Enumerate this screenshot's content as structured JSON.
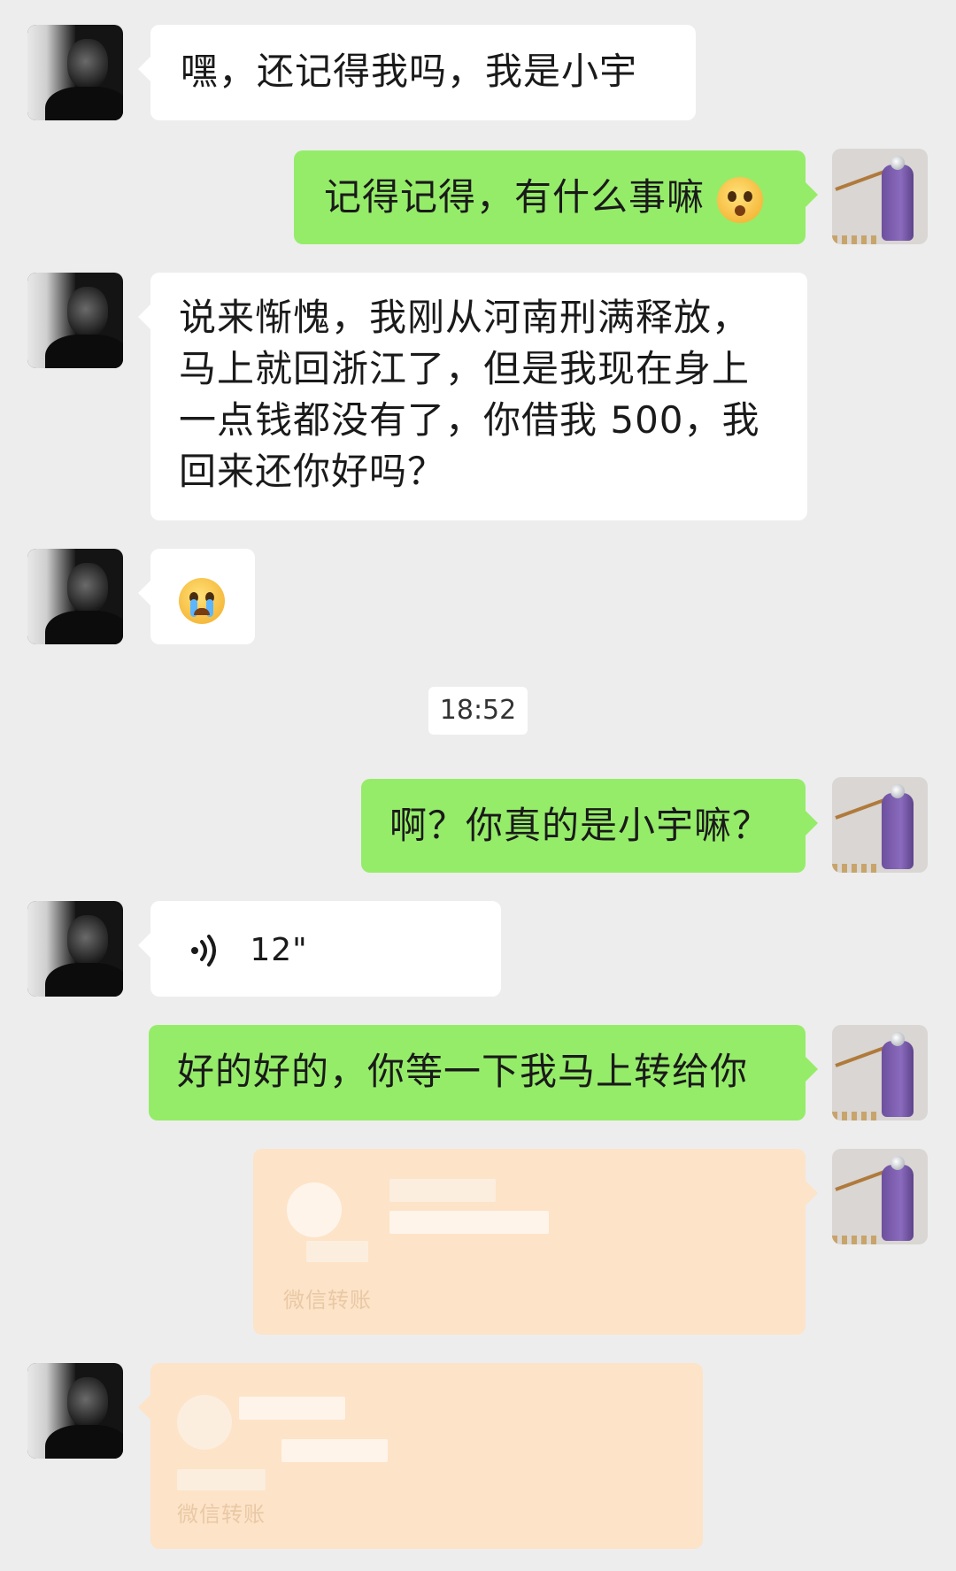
{
  "colors": {
    "background": "#ededed",
    "incoming_bubble": "#ffffff",
    "outgoing_bubble": "#95ec69",
    "transfer_bubble": "#fde3c8"
  },
  "messages": [
    {
      "side": "left",
      "type": "text",
      "text": "嘿，还记得我吗，我是小宇"
    },
    {
      "side": "right",
      "type": "text",
      "text": "记得记得，有什么事嘛",
      "emoji": "confused-face-icon"
    },
    {
      "side": "left",
      "type": "text",
      "lines": [
        "说来惭愧，我刚从河南刑满释放，",
        "马上就回浙江了，但是我现在身上",
        "一点钱都没有了，你借我 500，我",
        "回来还你好吗？"
      ]
    },
    {
      "side": "left",
      "type": "emoji",
      "emoji": "crying-face-icon"
    },
    {
      "side": "right",
      "type": "text",
      "text": "啊？你真的是小宇嘛？"
    },
    {
      "side": "left",
      "type": "voice",
      "duration": "12\""
    },
    {
      "side": "right",
      "type": "text",
      "text": "好的好的，你等一下我马上转给你"
    },
    {
      "side": "right",
      "type": "transfer",
      "label": "微信转账"
    },
    {
      "side": "left",
      "type": "transfer",
      "label": "微信转账"
    }
  ],
  "timestamp": "18:52"
}
